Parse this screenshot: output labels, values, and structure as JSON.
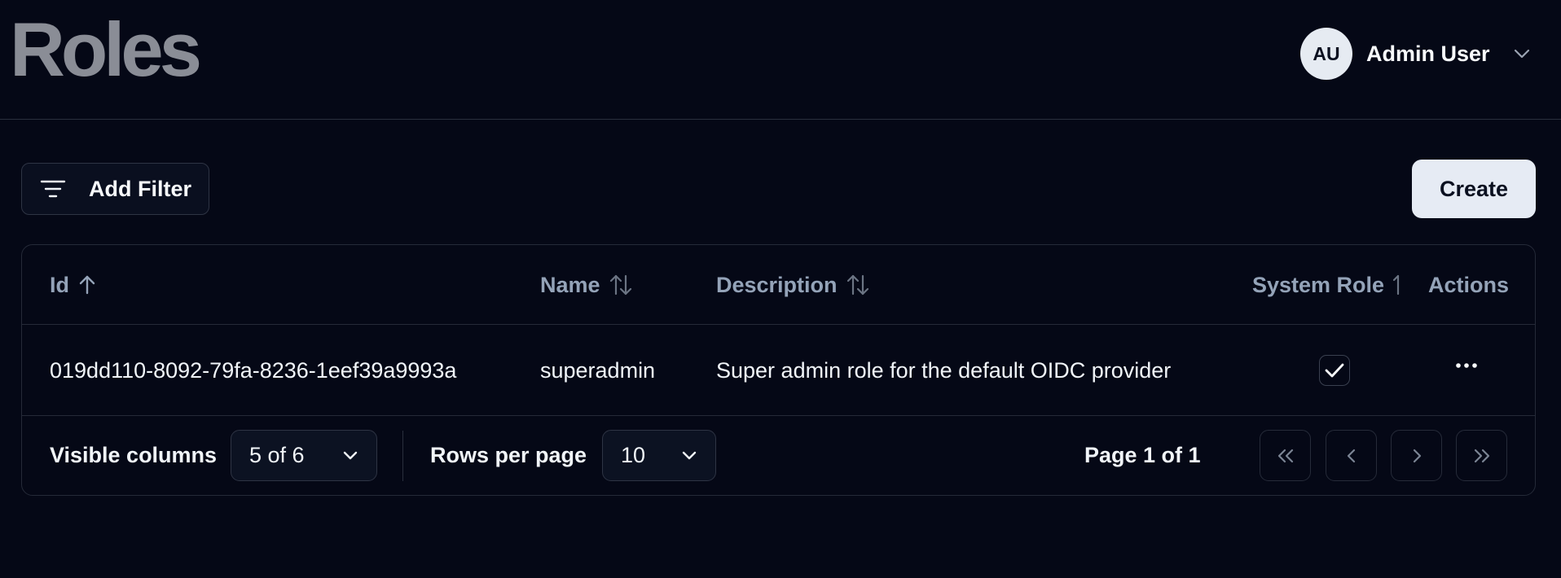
{
  "header": {
    "title": "Roles",
    "user": {
      "initials": "AU",
      "name": "Admin User"
    }
  },
  "toolbar": {
    "filter_label": "Add Filter",
    "create_label": "Create"
  },
  "table": {
    "columns": [
      {
        "label": "Id",
        "sort": "asc"
      },
      {
        "label": "Name",
        "sort": "none"
      },
      {
        "label": "Description",
        "sort": "none"
      },
      {
        "label": "System Role",
        "sort": "none"
      },
      {
        "label": "Actions"
      }
    ],
    "rows": [
      {
        "id": "019dd110-8092-79fa-8236-1eef39a9993a",
        "name": "superadmin",
        "description": "Super admin role for the default OIDC provider",
        "system_role": true
      }
    ]
  },
  "footer": {
    "visible_columns_label": "Visible columns",
    "visible_columns_value": "5 of 6",
    "rows_per_page_label": "Rows per page",
    "rows_per_page_value": "10",
    "page_info": "Page 1 of 1"
  },
  "colors": {
    "background": "#050816",
    "title": "#8a8d96",
    "header_text": "#94a3b8",
    "border": "#252a38",
    "button_light": "#e6ebf4"
  }
}
